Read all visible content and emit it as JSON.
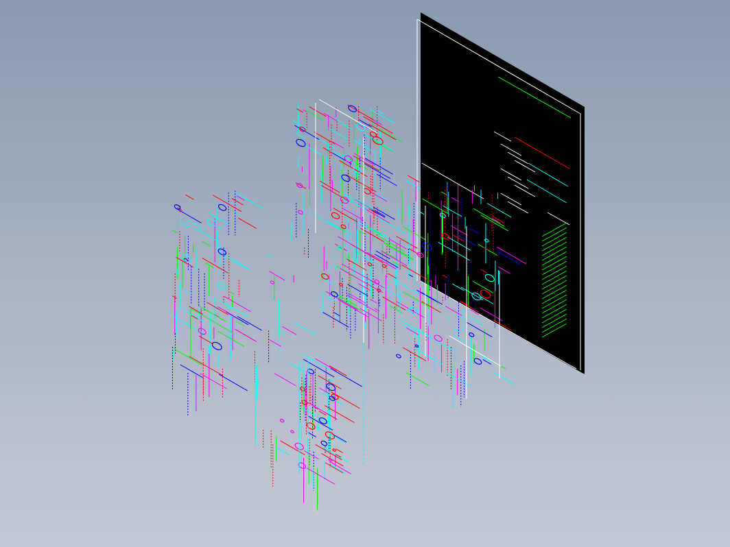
{
  "scene": {
    "type": "isometric-cad-drawing-view",
    "background_top": "#8a9ab0",
    "background_bottom": "#c6cad6",
    "drawing_sheet_color": "#000000",
    "sheet_edge_color": "#ffffff"
  },
  "palette": {
    "cyan": "#00ffff",
    "green": "#00ff00",
    "red": "#ff0000",
    "blue": "#0000ff",
    "magenta": "#ff00ff",
    "yellow": "#ffff00",
    "white": "#ffffff"
  },
  "layers": [
    {
      "name": "outline",
      "color": "cyan"
    },
    {
      "name": "dimension",
      "color": "green"
    },
    {
      "name": "centerline",
      "color": "red"
    },
    {
      "name": "hidden",
      "color": "blue"
    },
    {
      "name": "section",
      "color": "magenta"
    },
    {
      "name": "annotation",
      "color": "white"
    }
  ]
}
